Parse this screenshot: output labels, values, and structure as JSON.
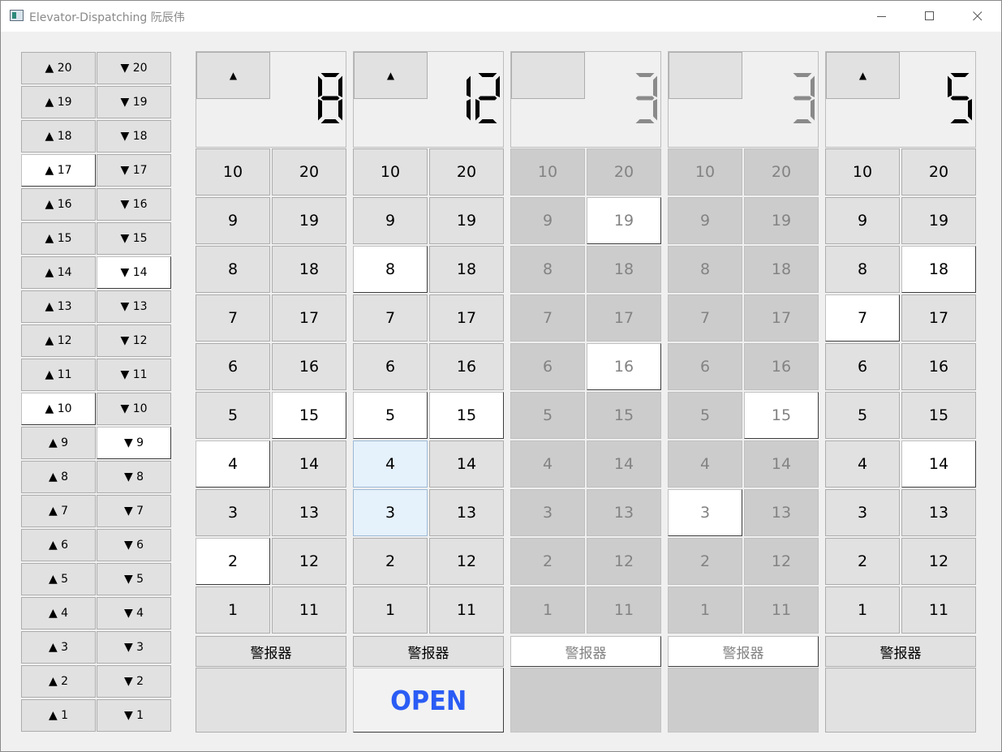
{
  "window": {
    "title": "Elevator-Dispatching 阮辰伟"
  },
  "hall_calls": {
    "floors": [
      20,
      19,
      18,
      17,
      16,
      15,
      14,
      13,
      12,
      11,
      10,
      9,
      8,
      7,
      6,
      5,
      4,
      3,
      2,
      1
    ],
    "up_prefix": "▲",
    "down_prefix": "▼",
    "up_active": [
      17,
      10
    ],
    "down_active": [
      14,
      9
    ]
  },
  "cars": [
    {
      "id": 1,
      "direction": "▲",
      "floor": "8",
      "disabled": false,
      "active_floors": [
        15,
        4,
        2
      ],
      "hover_floors": [],
      "alarm_label": "警报器",
      "door_open": false,
      "door_label": ""
    },
    {
      "id": 2,
      "direction": "▲",
      "floor": "12",
      "disabled": false,
      "active_floors": [
        8,
        5,
        15
      ],
      "hover_floors": [
        4,
        3
      ],
      "alarm_label": "警报器",
      "door_open": true,
      "door_label": "OPEN"
    },
    {
      "id": 3,
      "direction": "",
      "floor": "3",
      "disabled": true,
      "active_floors": [
        19,
        16
      ],
      "hover_floors": [],
      "alarm_label": "警报器",
      "door_open": false,
      "door_label": ""
    },
    {
      "id": 4,
      "direction": "",
      "floor": "3",
      "disabled": true,
      "active_floors": [
        15,
        3
      ],
      "hover_floors": [],
      "alarm_label": "警报器",
      "door_open": false,
      "door_label": ""
    },
    {
      "id": 5,
      "direction": "▲",
      "floor": "5",
      "disabled": false,
      "active_floors": [
        18,
        7,
        14
      ],
      "hover_floors": [],
      "alarm_label": "警报器",
      "door_open": false,
      "door_label": ""
    }
  ],
  "colors": {
    "button_face": "#e1e1e1",
    "button_active": "#ffffff",
    "disabled_face": "#cccccc",
    "open_text": "#2a5cf5"
  }
}
